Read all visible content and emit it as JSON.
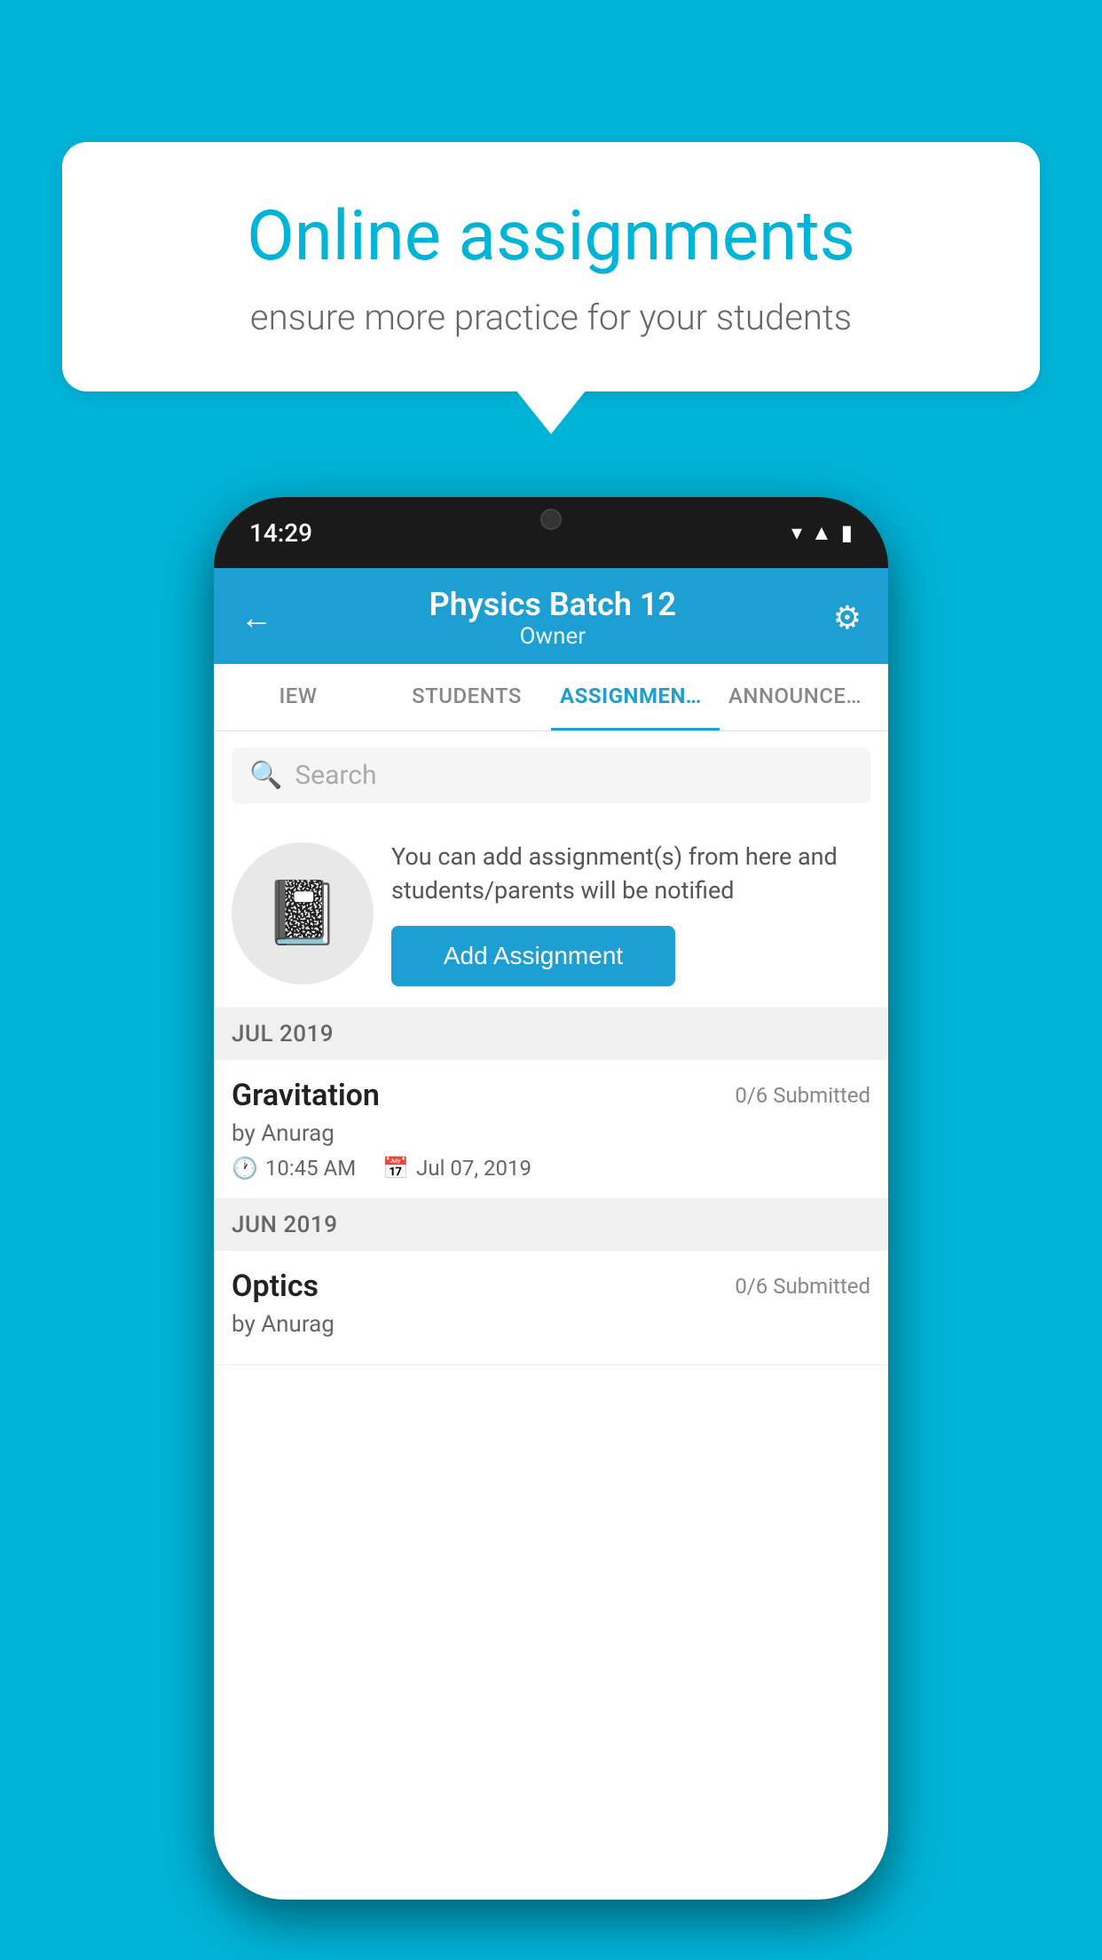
{
  "background": {
    "color": "#00b4d8"
  },
  "speech_bubble": {
    "title": "Online assignments",
    "subtitle": "ensure more practice for your students"
  },
  "phone": {
    "status_bar": {
      "time": "14:29",
      "icons": [
        "wifi",
        "signal",
        "battery"
      ]
    },
    "header": {
      "title": "Physics Batch 12",
      "subtitle": "Owner",
      "back_label": "←",
      "settings_label": "⚙"
    },
    "tabs": [
      {
        "label": "IEW",
        "active": false
      },
      {
        "label": "STUDENTS",
        "active": false
      },
      {
        "label": "ASSIGNMENTS",
        "active": true
      },
      {
        "label": "ANNOUNCEM…",
        "active": false
      }
    ],
    "search": {
      "placeholder": "Search"
    },
    "promo": {
      "description": "You can add assignment(s) from here and students/parents will be notified",
      "button_label": "Add Assignment"
    },
    "sections": [
      {
        "month": "JUL 2019",
        "assignments": [
          {
            "name": "Gravitation",
            "submitted": "0/6 Submitted",
            "author": "by Anurag",
            "time": "10:45 AM",
            "date": "Jul 07, 2019"
          }
        ]
      },
      {
        "month": "JUN 2019",
        "assignments": [
          {
            "name": "Optics",
            "submitted": "0/6 Submitted",
            "author": "by Anurag",
            "time": "",
            "date": ""
          }
        ]
      }
    ]
  }
}
